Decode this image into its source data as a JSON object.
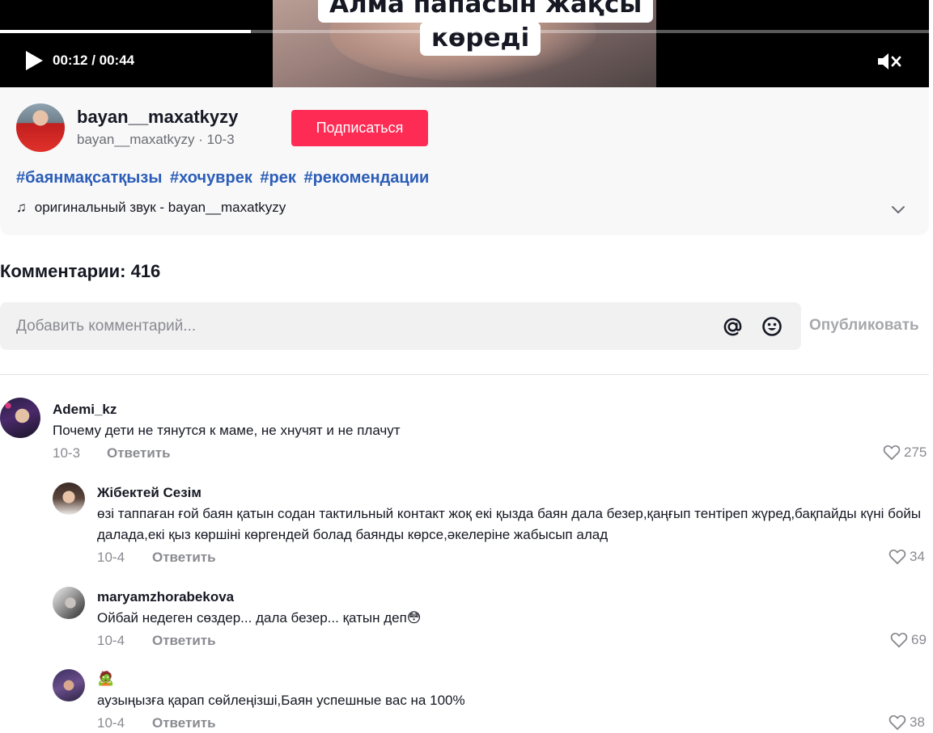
{
  "video": {
    "caption_line1": "Алма папасын жақсы",
    "caption_line2": "көреді",
    "time": "00:12 / 00:44",
    "progress": 0.27,
    "play_icon": "play-icon",
    "mute_icon": "volume-muted-icon"
  },
  "author": {
    "username": "bayan__maxatkyzy",
    "subline": "bayan__maxatkyzy · 10-3",
    "follow_label": "Подписаться",
    "hashtags": [
      "#баянмақсатқызы",
      "#хочуврек",
      "#рек",
      "#рекомендации"
    ],
    "music": "оригинальный звук - bayan__maxatkyzy"
  },
  "comments": {
    "title": "Комментарии: 416",
    "input_placeholder": "Добавить комментарий...",
    "publish_label": "Опубликовать",
    "items": [
      {
        "name": "Ademi_kz",
        "text": "Почему дети не тянутся к маме, не хнучят и не плачут",
        "date": "10-3",
        "reply": "Ответить",
        "likes": "275"
      },
      {
        "name": "Жібектей Сезім",
        "text": "өзі таппаған ғой баян қатын содан тактильный контакт жоқ екі қызда баян дала безер,қаңғып тентіреп жүред,бақпайды күні бойы далада,екі қыз көршіні көргендей болад баянды көрсе,әкелеріне жабысып алад",
        "date": "10-4",
        "reply": "Ответить",
        "likes": "34"
      },
      {
        "name": "maryamzhorabekova",
        "text": "Ойбай недеген сөздер... дала безер... қатын деп😳",
        "date": "10-4",
        "reply": "Ответить",
        "likes": "69"
      },
      {
        "name": "🧟",
        "text": "аузыңызға қарап сөйлеңізші,Баян успешные вас на 100%",
        "date": "10-4",
        "reply": "Ответить",
        "likes": "38"
      }
    ]
  },
  "colors": {
    "accent": "#fe2c55",
    "hashtag": "#2b5db9",
    "muted": "#8a8b91"
  }
}
